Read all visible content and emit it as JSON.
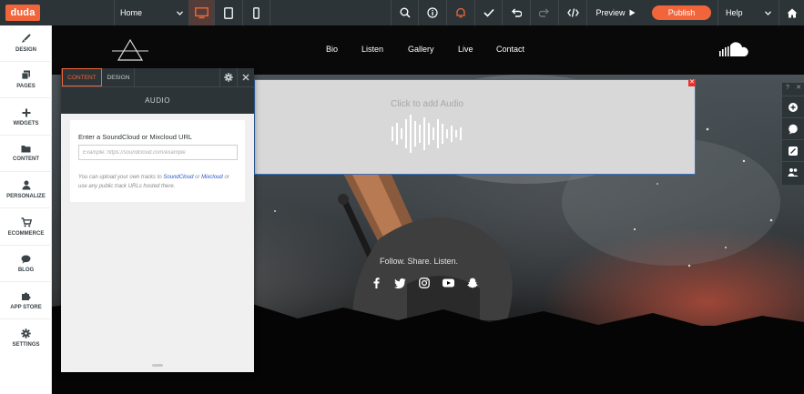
{
  "topbar": {
    "logo": "duda",
    "page_select": "Home",
    "preview_label": "Preview",
    "publish_label": "Publish",
    "help_label": "Help"
  },
  "sidebar": {
    "items": [
      {
        "label": "DESIGN",
        "icon": "brush-icon"
      },
      {
        "label": "PAGES",
        "icon": "pages-icon"
      },
      {
        "label": "WIDGETS",
        "icon": "plus-icon"
      },
      {
        "label": "CONTENT",
        "icon": "folder-icon"
      },
      {
        "label": "PERSONALIZE",
        "icon": "person-icon"
      },
      {
        "label": "ECOMMERCE",
        "icon": "cart-icon"
      },
      {
        "label": "BLOG",
        "icon": "speech-bubble-icon"
      },
      {
        "label": "APP STORE",
        "icon": "puzzle-icon"
      },
      {
        "label": "SETTINGS",
        "icon": "gear-icon"
      }
    ]
  },
  "site": {
    "nav": [
      "Bio",
      "Listen",
      "Gallery",
      "Live",
      "Contact"
    ],
    "follow_text": "Follow. Share. Listen.",
    "social": [
      "facebook-icon",
      "twitter-icon",
      "instagram-icon",
      "youtube-icon",
      "snapchat-icon"
    ]
  },
  "audio_widget": {
    "placeholder": "Click to add Audio"
  },
  "panel": {
    "tabs": [
      "CONTENT",
      "DESIGN"
    ],
    "title": "AUDIO",
    "field_label": "Enter a SoundCloud or Mixcloud URL",
    "input_placeholder": "Example: https://soundcloud.com/example",
    "help_part1": "You can upload your own tracks to ",
    "help_link1": "SoundCloud",
    "help_part2": " or ",
    "help_link2": "Mixcloud",
    "help_part3": " or use any public track URLs hosted there."
  },
  "colors": {
    "accent": "#f2653a",
    "toolbar": "#2d3437",
    "selection": "#3a6fb8",
    "link": "#2a57c9"
  }
}
